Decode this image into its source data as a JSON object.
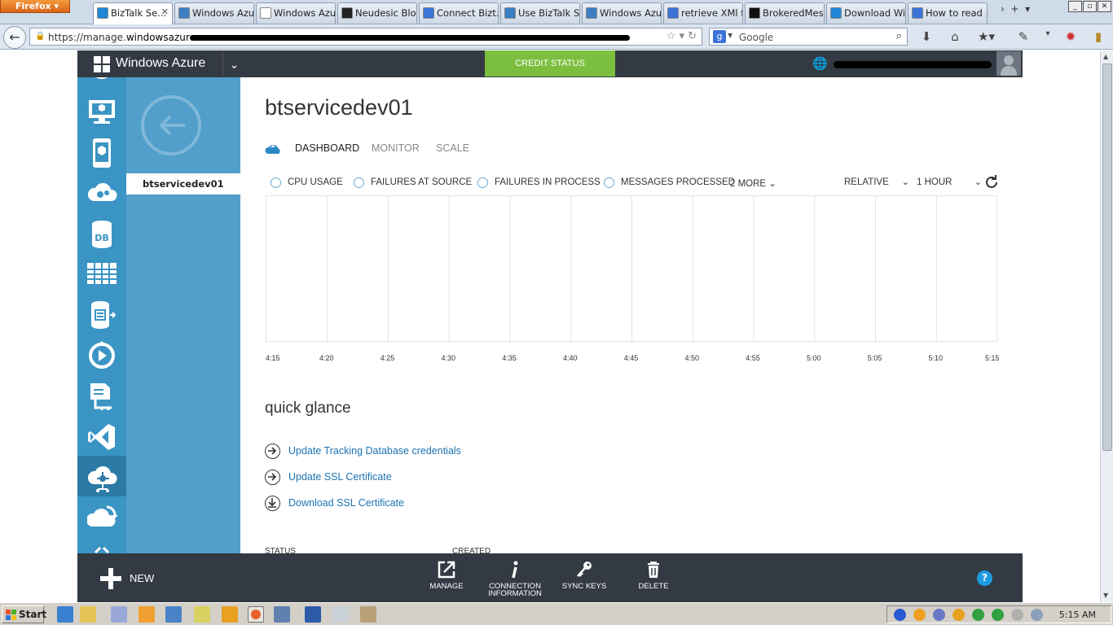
{
  "browser": {
    "button_label": "Firefox",
    "tabs": [
      {
        "label": "BizTalk Se...",
        "icon": "windows-icon",
        "color": "#1e88d6",
        "active": true
      },
      {
        "label": "Windows Azu...",
        "icon": "azure-icon",
        "color": "#3a7fc4"
      },
      {
        "label": "Windows Azu...",
        "icon": "blank-page-icon",
        "color": "#ffffff"
      },
      {
        "label": "Neudesic Blo...",
        "icon": "neudesic-icon",
        "color": "#222222"
      },
      {
        "label": "Connect Bizt...",
        "icon": "google-icon",
        "color": "#3b73d8"
      },
      {
        "label": "Use BizTalk S...",
        "icon": "azure-icon",
        "color": "#3a7fc4"
      },
      {
        "label": "Windows Azu...",
        "icon": "azure-icon",
        "color": "#3a7fc4"
      },
      {
        "label": "retrieve XMl f...",
        "icon": "google-icon",
        "color": "#3b73d8"
      },
      {
        "label": "BrokeredMes...",
        "icon": "m-icon",
        "color": "#111111"
      },
      {
        "label": "Download Wi...",
        "icon": "windows-icon",
        "color": "#1e88d6"
      },
      {
        "label": "How to read ...",
        "icon": "google-icon",
        "color": "#3b73d8"
      }
    ],
    "url_prefix": "https://manage.",
    "url_domain": "windowsazure.com",
    "search_placeholder": "Google"
  },
  "portal": {
    "brand": "Windows Azure",
    "credit_status": "CREDIT STATUS",
    "accent": "#7cbf3f",
    "nav_icons": [
      "scrolled-icon",
      "virtual-machines-icon",
      "mobile-services-icon",
      "cloud-services-icon",
      "sql-databases-icon",
      "storage-icon",
      "hdinsight-icon",
      "media-services-icon",
      "service-bus-icon",
      "visual-studio-online-icon",
      "biztalk-services-icon",
      "recovery-services-icon",
      "more-icon"
    ],
    "subnav_item": "btservicedev01"
  },
  "page": {
    "title": "btservicedev01",
    "tabs": [
      "DASHBOARD",
      "MONITOR",
      "SCALE"
    ],
    "metrics": [
      "CPU USAGE",
      "FAILURES AT SOURCE",
      "FAILURES IN PROCESS",
      "MESSAGES PROCESSED"
    ],
    "more_label": "2 MORE",
    "range_mode": "RELATIVE",
    "time_range": "1 HOUR",
    "quick_glance": {
      "title": "quick glance",
      "links": [
        {
          "label": "Update Tracking Database credentials",
          "icon": "arrow-right-circle-icon"
        },
        {
          "label": "Update SSL Certificate",
          "icon": "arrow-right-circle-icon"
        },
        {
          "label": "Download SSL Certificate",
          "icon": "download-circle-icon"
        }
      ]
    },
    "footer_labels": [
      "STATUS",
      "CREATED"
    ]
  },
  "chart_data": {
    "type": "line",
    "title": "",
    "x": [
      "4:15",
      "4:20",
      "4:25",
      "4:30",
      "4:35",
      "4:40",
      "4:45",
      "4:50",
      "4:55",
      "5:00",
      "5:05",
      "5:10",
      "5:15"
    ],
    "series": [],
    "grid": "vertical",
    "xlabel": "",
    "ylabel": ""
  },
  "command_bar": {
    "new_label": "NEW",
    "commands": [
      {
        "label": "MANAGE",
        "icon": "external-link-icon"
      },
      {
        "label": "CONNECTION INFORMATION",
        "icon": "info-icon"
      },
      {
        "label": "SYNC KEYS",
        "icon": "key-icon"
      },
      {
        "label": "DELETE",
        "icon": "trash-icon"
      }
    ],
    "help_label": "?"
  },
  "taskbar": {
    "start_label": "Start",
    "clock": "5:15 AM"
  }
}
